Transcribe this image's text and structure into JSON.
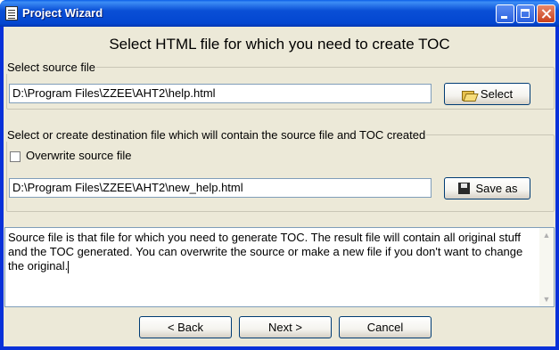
{
  "window": {
    "title": "Project Wizard"
  },
  "header": {
    "title": "Select HTML file for which you need to create TOC"
  },
  "source": {
    "legend": "Select source file",
    "path": "D:\\Program Files\\ZZEE\\AHT2\\help.html",
    "select_label": "Select"
  },
  "destination": {
    "legend": "Select or create destination file which will contain the source file and TOC created",
    "overwrite_label": "Overwrite source file",
    "overwrite_checked": false,
    "path": "D:\\Program Files\\ZZEE\\AHT2\\new_help.html",
    "save_label": "Save as"
  },
  "info": {
    "text": "Source file is that file for which you need to generate TOC. The result file will contain all original stuff and the TOC generated. You can overwrite the source or make a new file if you don't want to change the original."
  },
  "buttons": {
    "back": "< Back",
    "next": "Next >",
    "cancel": "Cancel"
  },
  "icons": {
    "title": "document-icon",
    "select": "folder-open-icon",
    "save": "floppy-disk-icon"
  }
}
